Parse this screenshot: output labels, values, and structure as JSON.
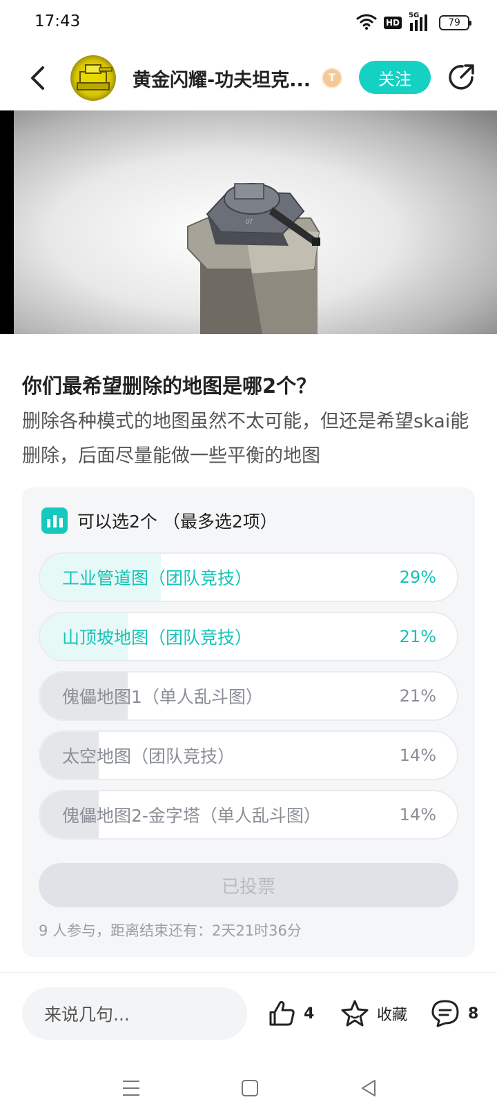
{
  "status_bar": {
    "time": "17:43",
    "hd_label": "HD",
    "network_label": "5G",
    "battery_level": "79"
  },
  "header": {
    "author_name": "黄金闪耀-功夫坦克...",
    "level_badge": "T",
    "follow_label": "关注"
  },
  "post": {
    "title": "你们最希望删除的地图是哪2个？",
    "body": "删除各种模式的地图虽然不太可能，但还是希望skai能删除，后面尽量能做一些平衡的地图"
  },
  "poll": {
    "header": "可以选2个 （最多选2项）",
    "accent_color": "#15c9bd",
    "options": [
      {
        "label": "工业管道图（团队竞技）",
        "percent": "29%",
        "fill": 0.29,
        "voted": true
      },
      {
        "label": "山顶坡地图（团队竞技）",
        "percent": "21%",
        "fill": 0.21,
        "voted": true
      },
      {
        "label": "傀儡地图1（单人乱斗图）",
        "percent": "21%",
        "fill": 0.21,
        "voted": false
      },
      {
        "label": "太空地图（团队竞技）",
        "percent": "14%",
        "fill": 0.14,
        "voted": false
      },
      {
        "label": "傀儡地图2-金字塔（单人乱斗图）",
        "percent": "14%",
        "fill": 0.14,
        "voted": false
      }
    ],
    "voted_button_label": "已投票",
    "footer": "9 人参与，距离结束还有：2天21时36分"
  },
  "bottom_bar": {
    "comment_placeholder": "来说几句...",
    "like_count": "4",
    "favorite_label": "收藏",
    "comment_count": "8"
  },
  "icons": {
    "back": "back-arrow-icon",
    "share": "share-icon",
    "like": "thumbs-up-icon",
    "favorite": "star-icon",
    "comment": "comment-bubble-icon"
  }
}
